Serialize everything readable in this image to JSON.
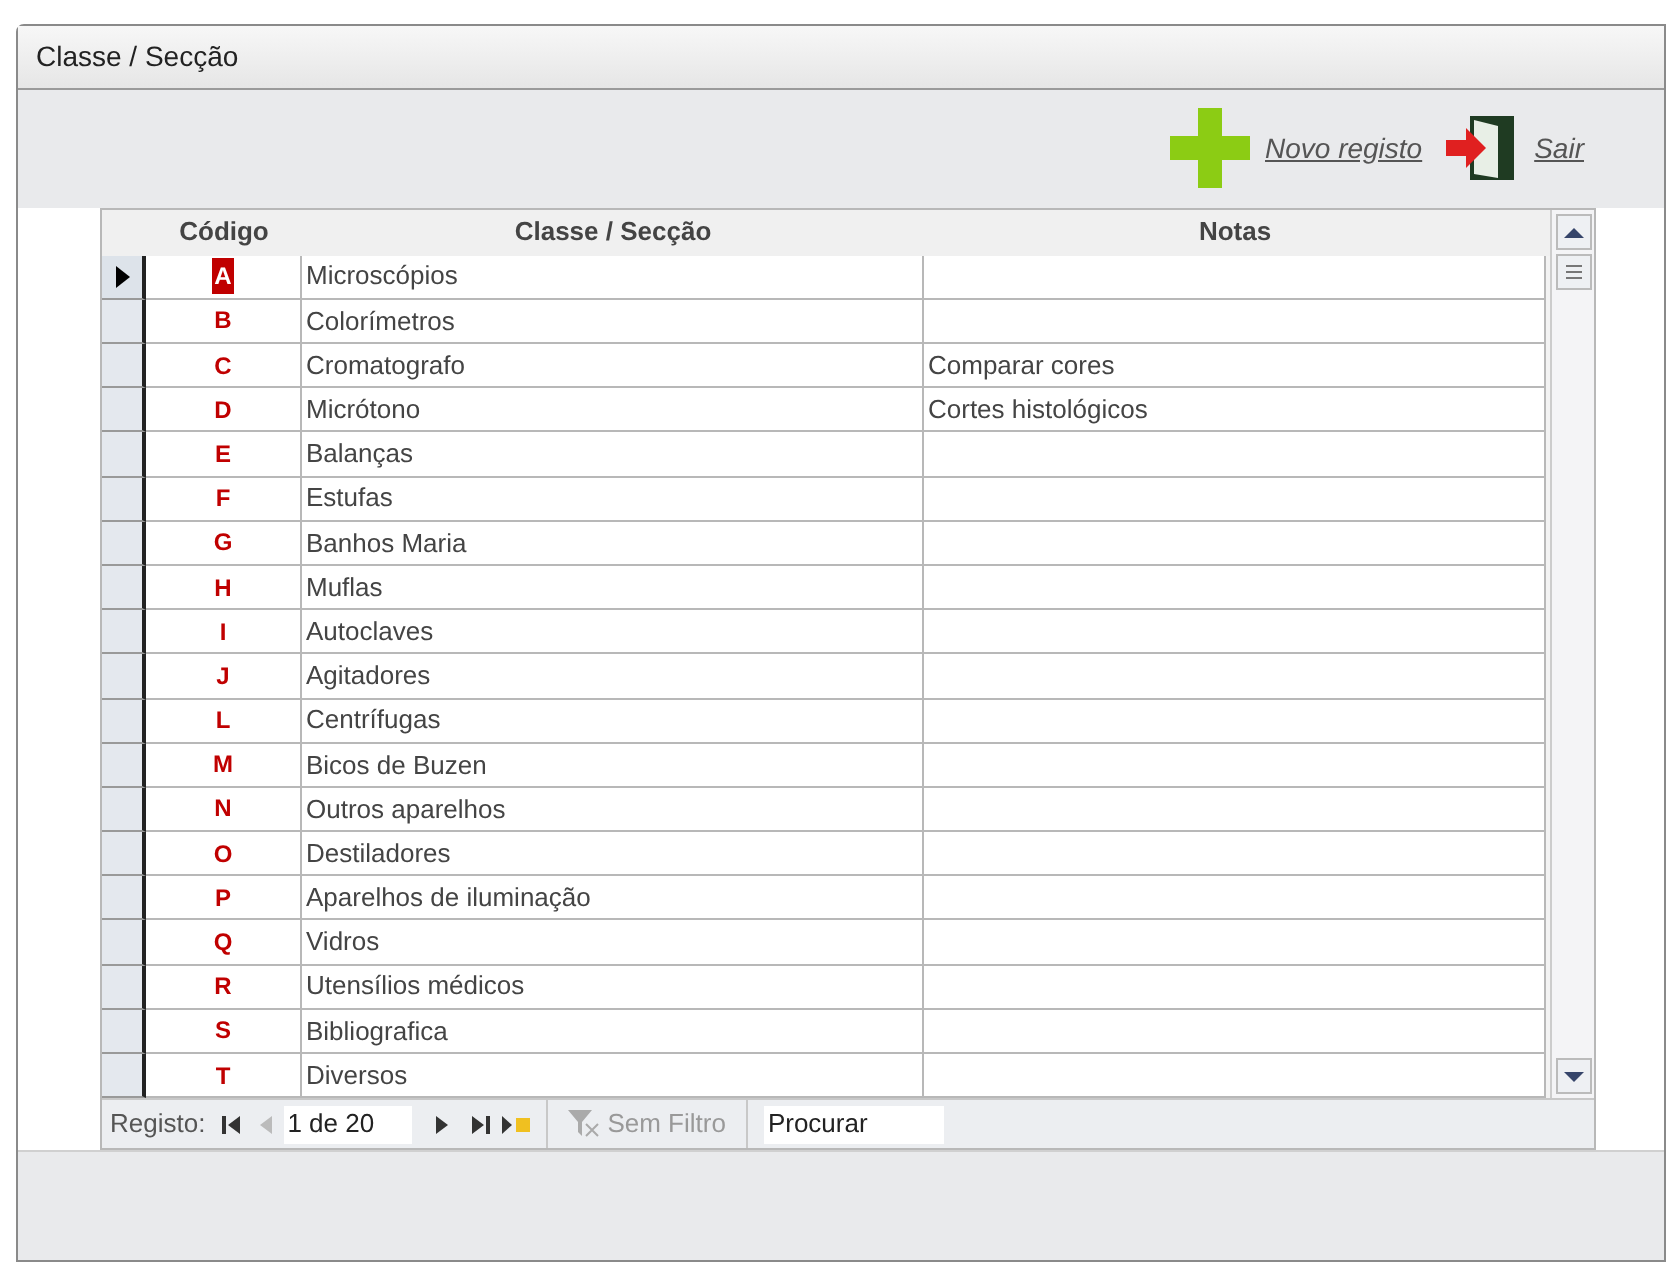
{
  "window": {
    "title": "Classe / Secção"
  },
  "toolbar": [
    {
      "kind": "new",
      "label": "Novo registo"
    },
    {
      "kind": "exit",
      "label": "Sair"
    }
  ],
  "table": {
    "columns": [
      "Código",
      "Classe / Secção",
      "Notas"
    ],
    "rows": [
      {
        "code": "A",
        "name": "Microscópios",
        "notes": "",
        "selected": true
      },
      {
        "code": "B",
        "name": "Colorímetros",
        "notes": "",
        "selected": false
      },
      {
        "code": "C",
        "name": "Cromatografo",
        "notes": "Comparar cores",
        "selected": false
      },
      {
        "code": "D",
        "name": "Micrótono",
        "notes": "Cortes histológicos",
        "selected": false
      },
      {
        "code": "E",
        "name": "Balanças",
        "notes": "",
        "selected": false
      },
      {
        "code": "F",
        "name": "Estufas",
        "notes": "",
        "selected": false
      },
      {
        "code": "G",
        "name": "Banhos Maria",
        "notes": "",
        "selected": false
      },
      {
        "code": "H",
        "name": "Muflas",
        "notes": "",
        "selected": false
      },
      {
        "code": "I",
        "name": "Autoclaves",
        "notes": "",
        "selected": false
      },
      {
        "code": "J",
        "name": "Agitadores",
        "notes": "",
        "selected": false
      },
      {
        "code": "L",
        "name": "Centrífugas",
        "notes": "",
        "selected": false
      },
      {
        "code": "M",
        "name": "Bicos de Buzen",
        "notes": "",
        "selected": false
      },
      {
        "code": "N",
        "name": "Outros aparelhos",
        "notes": "",
        "selected": false
      },
      {
        "code": "O",
        "name": "Destiladores",
        "notes": "",
        "selected": false
      },
      {
        "code": "P",
        "name": "Aparelhos de iluminação",
        "notes": "",
        "selected": false
      },
      {
        "code": "Q",
        "name": "Vidros",
        "notes": "",
        "selected": false
      },
      {
        "code": "R",
        "name": "Utensílios médicos",
        "notes": "",
        "selected": false
      },
      {
        "code": "S",
        "name": "Bibliografica",
        "notes": "",
        "selected": false
      },
      {
        "code": "T",
        "name": "Diversos",
        "notes": "",
        "selected": false
      }
    ]
  },
  "navigation": {
    "label": "Registo:",
    "record": "1 de 20",
    "filter": "Sem Filtro",
    "search_placeholder": "Procurar"
  }
}
